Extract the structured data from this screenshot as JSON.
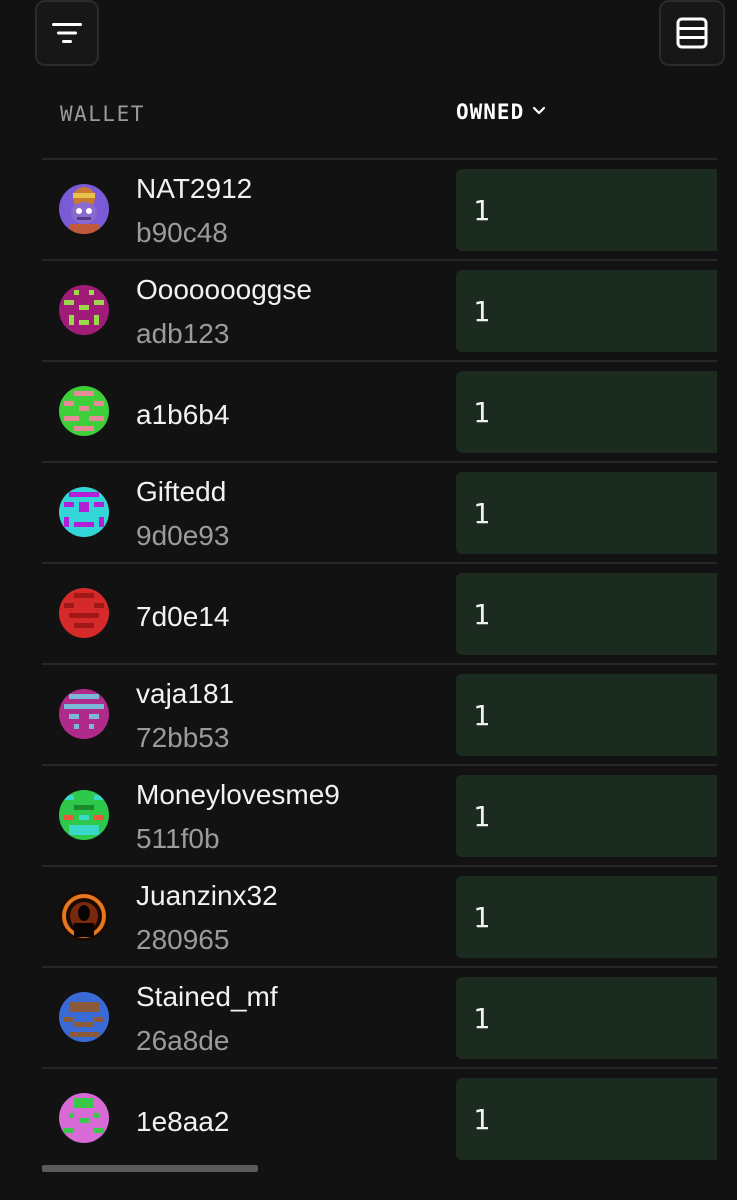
{
  "columns": {
    "wallet": "WALLET",
    "owned": "OWNED"
  },
  "icons": {
    "filter": "filter-icon",
    "view": "table-view-icon",
    "sort": "chevron-down-icon"
  },
  "colors": {
    "background": "#121212",
    "owned_cell": "#1b2b1f",
    "muted_text": "#9b9b9b"
  },
  "rows": [
    {
      "name": "NAT2912",
      "address": "b90c48",
      "owned": "1"
    },
    {
      "name": "Oooooooggse",
      "address": "adb123",
      "owned": "1"
    },
    {
      "name": "a1b6b4",
      "address": "",
      "owned": "1"
    },
    {
      "name": "Giftedd",
      "address": "9d0e93",
      "owned": "1"
    },
    {
      "name": "7d0e14",
      "address": "",
      "owned": "1"
    },
    {
      "name": "vaja181",
      "address": "72bb53",
      "owned": "1"
    },
    {
      "name": "Moneylovesme9",
      "address": "511f0b",
      "owned": "1"
    },
    {
      "name": "Juanzinx32",
      "address": "280965",
      "owned": "1"
    },
    {
      "name": "Stained_mf",
      "address": "26a8de",
      "owned": "1"
    },
    {
      "name": "1e8aa2",
      "address": "",
      "owned": "1"
    }
  ]
}
